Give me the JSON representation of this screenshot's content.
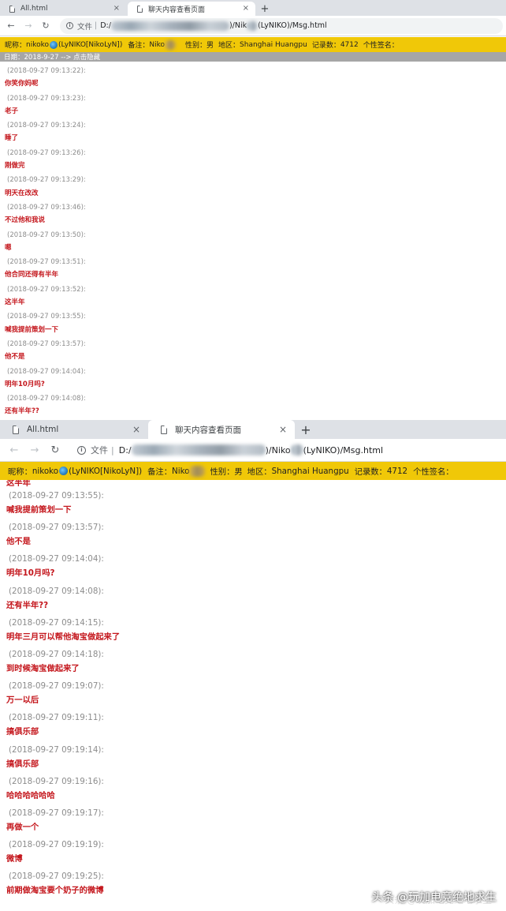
{
  "window1": {
    "tabs": [
      {
        "label": "All.html",
        "active": false
      },
      {
        "label": "聊天内容查看页面",
        "active": true
      }
    ],
    "new_tab_symbol": "+",
    "close_symbol": "×",
    "nav": {
      "back": "←",
      "forward": "→",
      "reload": "↻"
    },
    "address": {
      "info": "i",
      "scheme": "文件",
      "separator": "|",
      "prefix": "D:/",
      "path_mid": ")/Nik",
      "path_end": "(LyNIKO)/Msg.html"
    },
    "info_bar": {
      "nickname_label": "昵称：",
      "nickname": "nikoko",
      "account": "(LyNIKO[NikoLyN])",
      "note_label": "备注：",
      "note": "Niko",
      "gender_label": "性别：",
      "gender": "男",
      "region_label": "地区：",
      "region": "Shanghai Huangpu",
      "records_label": "记录数：",
      "records": "4712",
      "signature_label": "个性签名："
    },
    "date_bar": "日期：2018-9-27  -->  点击隐藏",
    "messages": [
      {
        "time": "(2018-09-27 09:13:22):",
        "text": "你笑你妈呢"
      },
      {
        "time": "(2018-09-27 09:13:23):",
        "text": "老子"
      },
      {
        "time": "(2018-09-27 09:13:24):",
        "text": "睡了"
      },
      {
        "time": "(2018-09-27 09:13:26):",
        "text": "刚做完"
      },
      {
        "time": "(2018-09-27 09:13:29):",
        "text": "明天在改改"
      },
      {
        "time": "(2018-09-27 09:13:46):",
        "text": "不过他和我说"
      },
      {
        "time": "(2018-09-27 09:13:50):",
        "text": "嗯"
      },
      {
        "time": "(2018-09-27 09:13:51):",
        "text": "他合同还得有半年"
      },
      {
        "time": "(2018-09-27 09:13:52):",
        "text": "这半年"
      },
      {
        "time": "(2018-09-27 09:13:55):",
        "text": "喊我提前策划一下"
      },
      {
        "time": "(2018-09-27 09:13:57):",
        "text": "他不是"
      },
      {
        "time": "(2018-09-27 09:14:04):",
        "text": "明年10月吗?"
      },
      {
        "time": "(2018-09-27 09:14:08):",
        "text": "还有半年??"
      }
    ]
  },
  "window2": {
    "tabs": [
      {
        "label": "All.html",
        "active": false
      },
      {
        "label": "聊天内容查看页面",
        "active": true
      }
    ],
    "new_tab_symbol": "+",
    "close_symbol": "×",
    "nav": {
      "back": "←",
      "forward": "→",
      "reload": "↻"
    },
    "address": {
      "info": "i",
      "scheme": "文件",
      "separator": "|",
      "prefix": "D:/",
      "path_mid": ")/Niko",
      "path_end": "(LyNIKO)/Msg.html"
    },
    "info_bar": {
      "nickname_label": "昵称：",
      "nickname": "nikoko",
      "account": "(LyNIKO[NikoLyN])",
      "note_label": "备注：",
      "note": "Niko",
      "gender_label": "性别：",
      "gender": "男",
      "region_label": "地区：",
      "region": "Shanghai Huangpu",
      "records_label": "记录数：",
      "records": "4712",
      "signature_label": "个性签名："
    },
    "partial_top_text": "这半年",
    "messages": [
      {
        "time": "(2018-09-27 09:13:55):",
        "text": "喊我提前策划一下"
      },
      {
        "time": "(2018-09-27 09:13:57):",
        "text": "他不是"
      },
      {
        "time": "(2018-09-27 09:14:04):",
        "text": "明年10月吗?"
      },
      {
        "time": "(2018-09-27 09:14:08):",
        "text": "还有半年??"
      },
      {
        "time": "(2018-09-27 09:14:15):",
        "text": "明年三月可以帮他淘宝做起来了"
      },
      {
        "time": "(2018-09-27 09:14:18):",
        "text": "到时候淘宝做起来了"
      },
      {
        "time": "(2018-09-27 09:19:07):",
        "text": "万一以后"
      },
      {
        "time": "(2018-09-27 09:19:11):",
        "text": "搞俱乐部"
      },
      {
        "time": "(2018-09-27 09:19:14):",
        "text": "搞俱乐部"
      },
      {
        "time": "(2018-09-27 09:19:16):",
        "text": "哈哈哈哈哈哈"
      },
      {
        "time": "(2018-09-27 09:19:17):",
        "text": "再做一个"
      },
      {
        "time": "(2018-09-27 09:19:19):",
        "text": "微博"
      },
      {
        "time": "(2018-09-27 09:19:25):",
        "text": "前期做淘宝要个奶子的微博"
      }
    ]
  },
  "watermark": "头条 @玩加电竞绝地求生",
  "colors": {
    "tabbar": "#dee1e6",
    "info_bar": "#f0c808",
    "date_bar": "#a6a6a6",
    "timestamp": "#8c8c8c",
    "message_text": "#c4161c"
  }
}
